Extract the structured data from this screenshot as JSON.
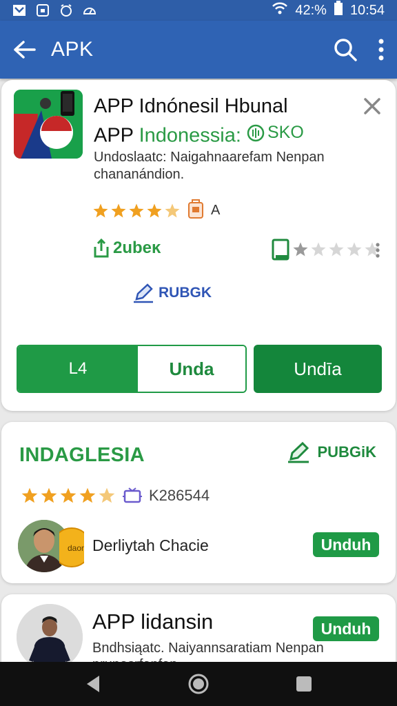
{
  "status_bar": {
    "battery": "42:%",
    "time": "10:54",
    "icons": [
      "mail-icon",
      "sim-icon",
      "alarm-icon",
      "speedometer-icon",
      "wifi-icon",
      "battery-icon"
    ]
  },
  "app_bar": {
    "title": "APK",
    "back_icon": "arrow-left-icon",
    "search_icon": "search-icon",
    "menu_icon": "more-vert-icon"
  },
  "card1": {
    "title": "APP Idnónesil Hbunal",
    "subtitle_prefix": "APP",
    "subtitle_green": "Indonessia:",
    "subtitle_badge": "SKO",
    "description": "Undoslaatc: Naigahnaarefam Nenpan chananándion.",
    "rating_stars": 4,
    "rating_label": "A",
    "downloads_label": "2ubeĸ",
    "rating2_stars": 1,
    "publish_label": "RUBGK",
    "seg_left": "L4",
    "seg_right": "Unda",
    "primary_button": "Undīa"
  },
  "card2": {
    "title": "INDAGLESIA",
    "publish_label": "PUBGiK",
    "rating_stars": 4,
    "rating_count": "K286544",
    "developer_name": "Derliytah Chacie",
    "coin_text": "daon",
    "button": "Unduh"
  },
  "card3": {
    "title": "APP lidansin",
    "description_line1": "Bndhsiąatc. Naiyannsaratiam Nenpan",
    "description_line2": "prunasrfanfan",
    "button": "Unduh"
  },
  "colors": {
    "app_bar": "#2f63b4",
    "green": "#1f9a46",
    "dark_green": "#14863b",
    "star": "#f0a020"
  }
}
